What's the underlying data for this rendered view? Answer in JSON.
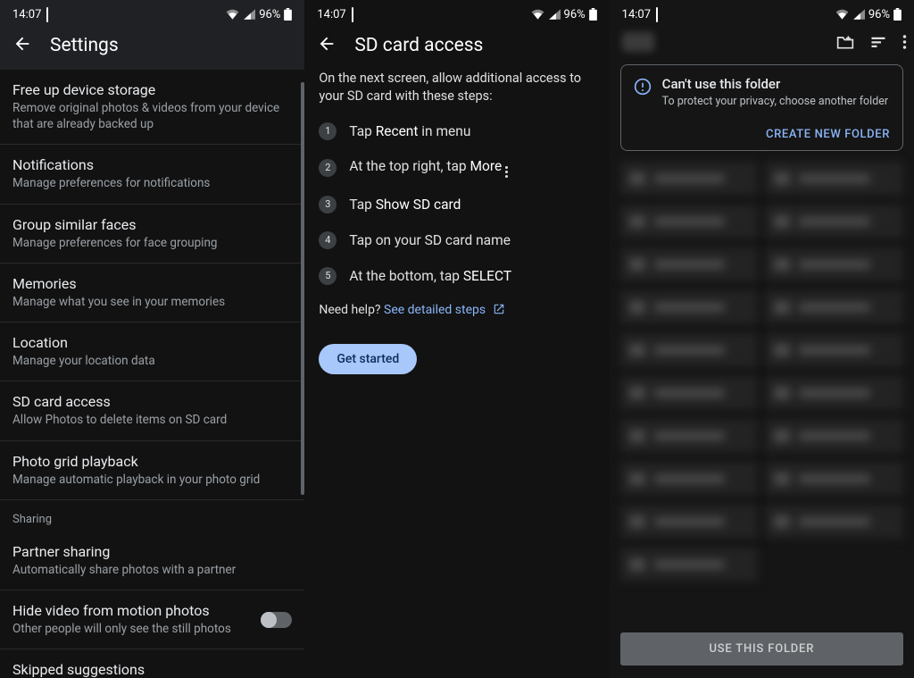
{
  "status": {
    "time": "14:07",
    "battery": "96%"
  },
  "panel1": {
    "title": "Settings",
    "items": [
      {
        "title": "Free up device storage",
        "subtitle": "Remove original photos & videos from your device that are already backed up"
      },
      {
        "title": "Notifications",
        "subtitle": "Manage preferences for notifications"
      },
      {
        "title": "Group similar faces",
        "subtitle": "Manage preferences for face grouping"
      },
      {
        "title": "Memories",
        "subtitle": "Manage what you see in your memories"
      },
      {
        "title": "Location",
        "subtitle": "Manage your location data"
      },
      {
        "title": "SD card access",
        "subtitle": "Allow Photos to delete items on SD card"
      },
      {
        "title": "Photo grid playback",
        "subtitle": "Manage automatic playback in your photo grid"
      }
    ],
    "section_sharing": "Sharing",
    "partner": {
      "title": "Partner sharing",
      "subtitle": "Automatically share photos with a partner"
    },
    "hidevideo": {
      "title": "Hide video from motion photos",
      "subtitle": "Other people will only see the still photos"
    },
    "skipped": {
      "title": "Skipped suggestions"
    }
  },
  "panel2": {
    "title": "SD card access",
    "intro": "On the next screen, allow additional access to your SD card with these steps:",
    "steps": {
      "s1a": "Tap ",
      "s1b": "Recent",
      "s1c": " in menu",
      "s2a": "At the top right, tap ",
      "s2b": "More",
      "s3a": "Tap ",
      "s3b": "Show SD card",
      "s4": "Tap on your SD card name",
      "s5a": "At the bottom, tap ",
      "s5b": "SELECT"
    },
    "help_prefix": "Need help? ",
    "help_link": "See detailed steps",
    "get_started": "Get started"
  },
  "panel3": {
    "card_title": "Can't use this folder",
    "card_sub": "To protect your privacy, choose another folder",
    "card_action": "CREATE NEW FOLDER",
    "use_btn": "USE THIS FOLDER"
  }
}
